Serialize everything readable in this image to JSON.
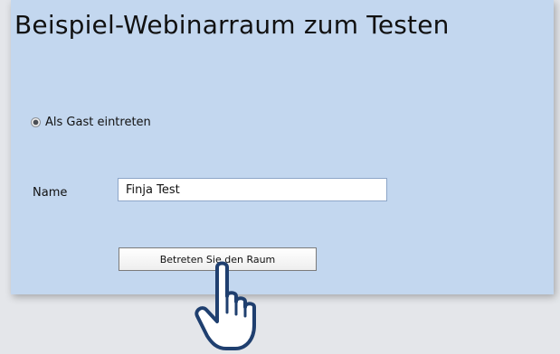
{
  "room": {
    "title": "Beispiel-Webinarraum zum Testen"
  },
  "guest_option": {
    "label": "Als Gast eintreten",
    "selected": true
  },
  "name_field": {
    "label": "Name",
    "value": "Finja Test"
  },
  "enter_button": {
    "label": "Betreten Sie den Raum"
  },
  "cursor": {
    "icon": "hand-pointer-icon"
  },
  "colors": {
    "panel_background": "#c3d7ef",
    "page_background": "#e4e6ea",
    "cursor_outline": "#1f3f6f"
  }
}
